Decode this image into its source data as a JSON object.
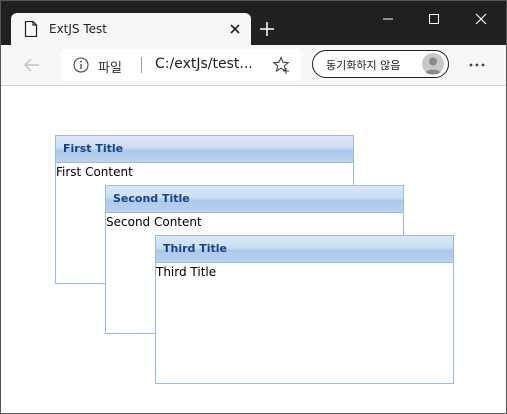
{
  "browser": {
    "tab": {
      "title": "ExtJS Test"
    },
    "address": {
      "site_label": "파일",
      "url": "C:/extJs/test..."
    },
    "sync": {
      "label": "동기화하지 않음"
    }
  },
  "panels": [
    {
      "title": "First Title",
      "content": "First Content"
    },
    {
      "title": "Second Title",
      "content": "Second Content"
    },
    {
      "title": "Third Title",
      "content": "Third Title"
    }
  ],
  "colors": {
    "panel_border": "#99bbe8",
    "panel_title": "#15428b",
    "titlebar": "#202020"
  }
}
